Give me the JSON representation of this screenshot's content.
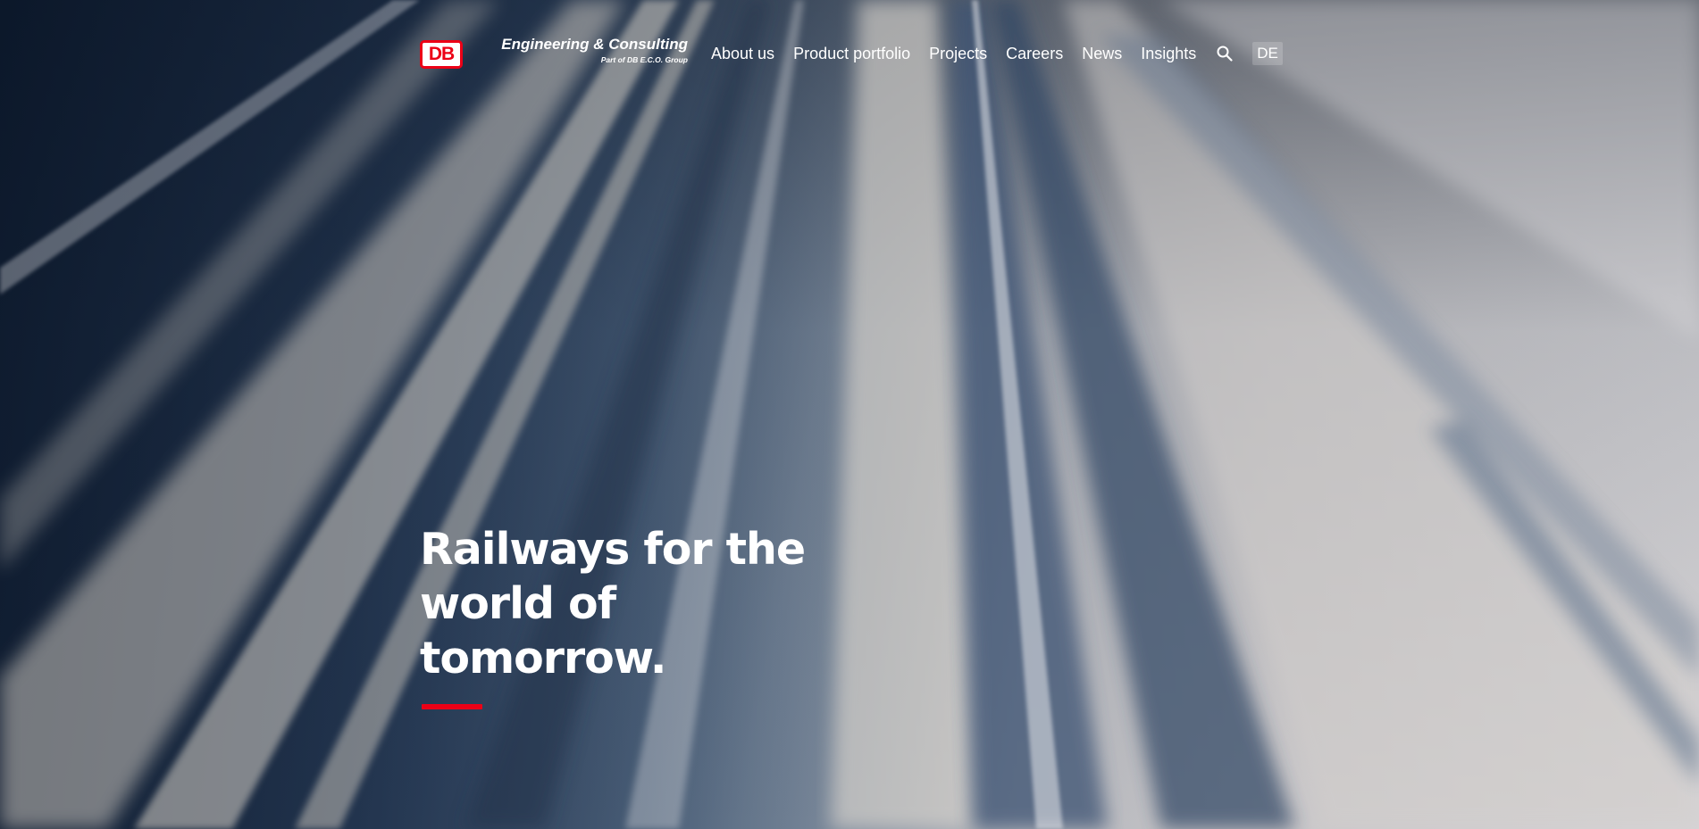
{
  "brand": {
    "logo_text": "DB",
    "title": "Engineering & Consulting",
    "subtitle": "Part of DB E.C.O. Group"
  },
  "nav": {
    "items": [
      {
        "label": "About us"
      },
      {
        "label": "Product portfolio"
      },
      {
        "label": "Projects"
      },
      {
        "label": "Careers"
      },
      {
        "label": "News"
      },
      {
        "label": "Insights"
      }
    ],
    "search_icon": "search-icon",
    "language_label": "DE"
  },
  "hero": {
    "headline_lines": [
      "Railways for the",
      "world of",
      "tomorrow."
    ]
  },
  "colors": {
    "accent": "#ec0016",
    "text_on_dark": "#ffffff"
  }
}
